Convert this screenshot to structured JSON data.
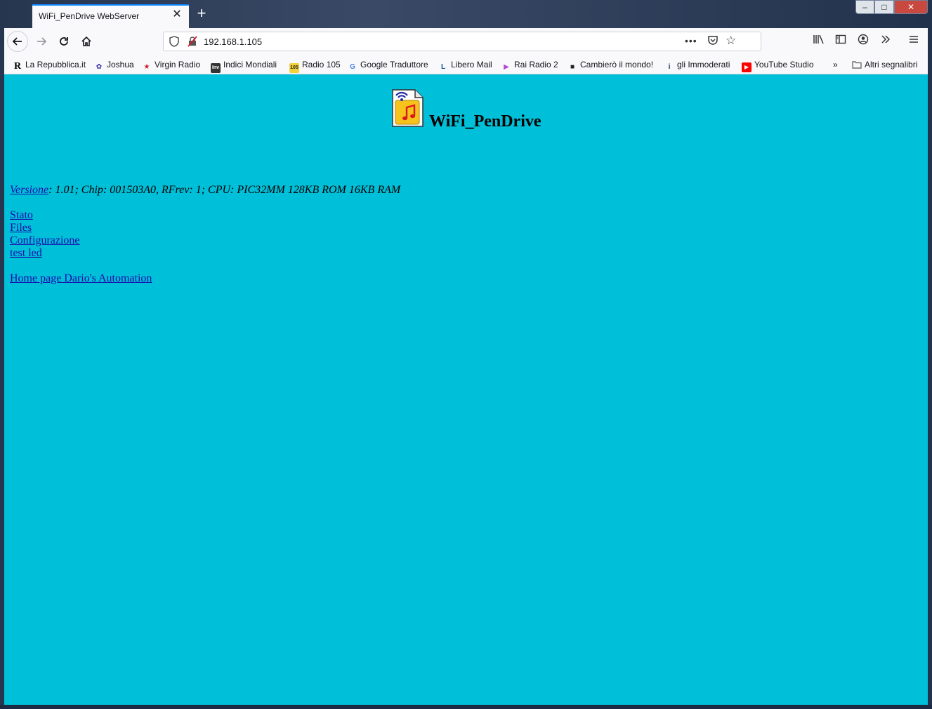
{
  "browser": {
    "tab_title": "WiFi_PenDrive WebServer",
    "tab_close": "✕",
    "new_tab": "+",
    "window_controls": {
      "minimize": "–",
      "maximize": "□",
      "close": "✕"
    },
    "url": "192.168.1.105",
    "url_more": "•••",
    "icons": {
      "back": "back-arrow-icon",
      "forward": "forward-arrow-icon",
      "reload": "reload-icon",
      "home": "home-icon",
      "shield": "tracking-shield-icon",
      "insecure": "insecure-connection-icon",
      "pocket": "pocket-icon",
      "star": "bookmark-star-icon",
      "library": "library-icon",
      "sidebar": "sidebar-icon",
      "account": "account-icon",
      "overflow": "overflow-icon",
      "menu": "hamburger-menu-icon"
    }
  },
  "bookmarks": [
    {
      "label": "La Repubblica.it",
      "icon": "R",
      "color": "#000000"
    },
    {
      "label": "Joshua",
      "icon": "✿",
      "color": "#3a2ea8"
    },
    {
      "label": "Virgin Radio",
      "icon": "★",
      "color": "#d0202e"
    },
    {
      "label": "Indici Mondiali",
      "icon": "Inv",
      "color": "#333333"
    },
    {
      "label": "Radio 105",
      "icon": "105",
      "color": "#c9a000"
    },
    {
      "label": "Google Traduttore",
      "icon": "G",
      "color": "#4a7fe6"
    },
    {
      "label": "Libero Mail",
      "icon": "L",
      "color": "#1a4fa0"
    },
    {
      "label": "Rai Radio 2",
      "icon": "▶",
      "color": "#b04bd0"
    },
    {
      "label": "Cambierò il mondo!",
      "icon": "■",
      "color": "#222222"
    },
    {
      "label": "gli Immoderati",
      "icon": "i",
      "color": "#1a2a66"
    },
    {
      "label": "YouTube Studio",
      "icon": "▶",
      "color": "#ff0000"
    }
  ],
  "bookmarks_overflow": "»",
  "other_bookmarks": "Altri segnalibri",
  "page": {
    "title": "WiFi_PenDrive",
    "version_link": "Versione",
    "version_info": ": 1.01; Chip: 001503A0, RFrev: 1; CPU: PIC32MM 128KB ROM 16KB RAM",
    "links": [
      "Stato",
      "Files",
      "Configurazione",
      "test led"
    ],
    "home_link": "Home page Dario's Automation",
    "background_color": "#00bfd8",
    "link_color": "#1a0dab"
  }
}
